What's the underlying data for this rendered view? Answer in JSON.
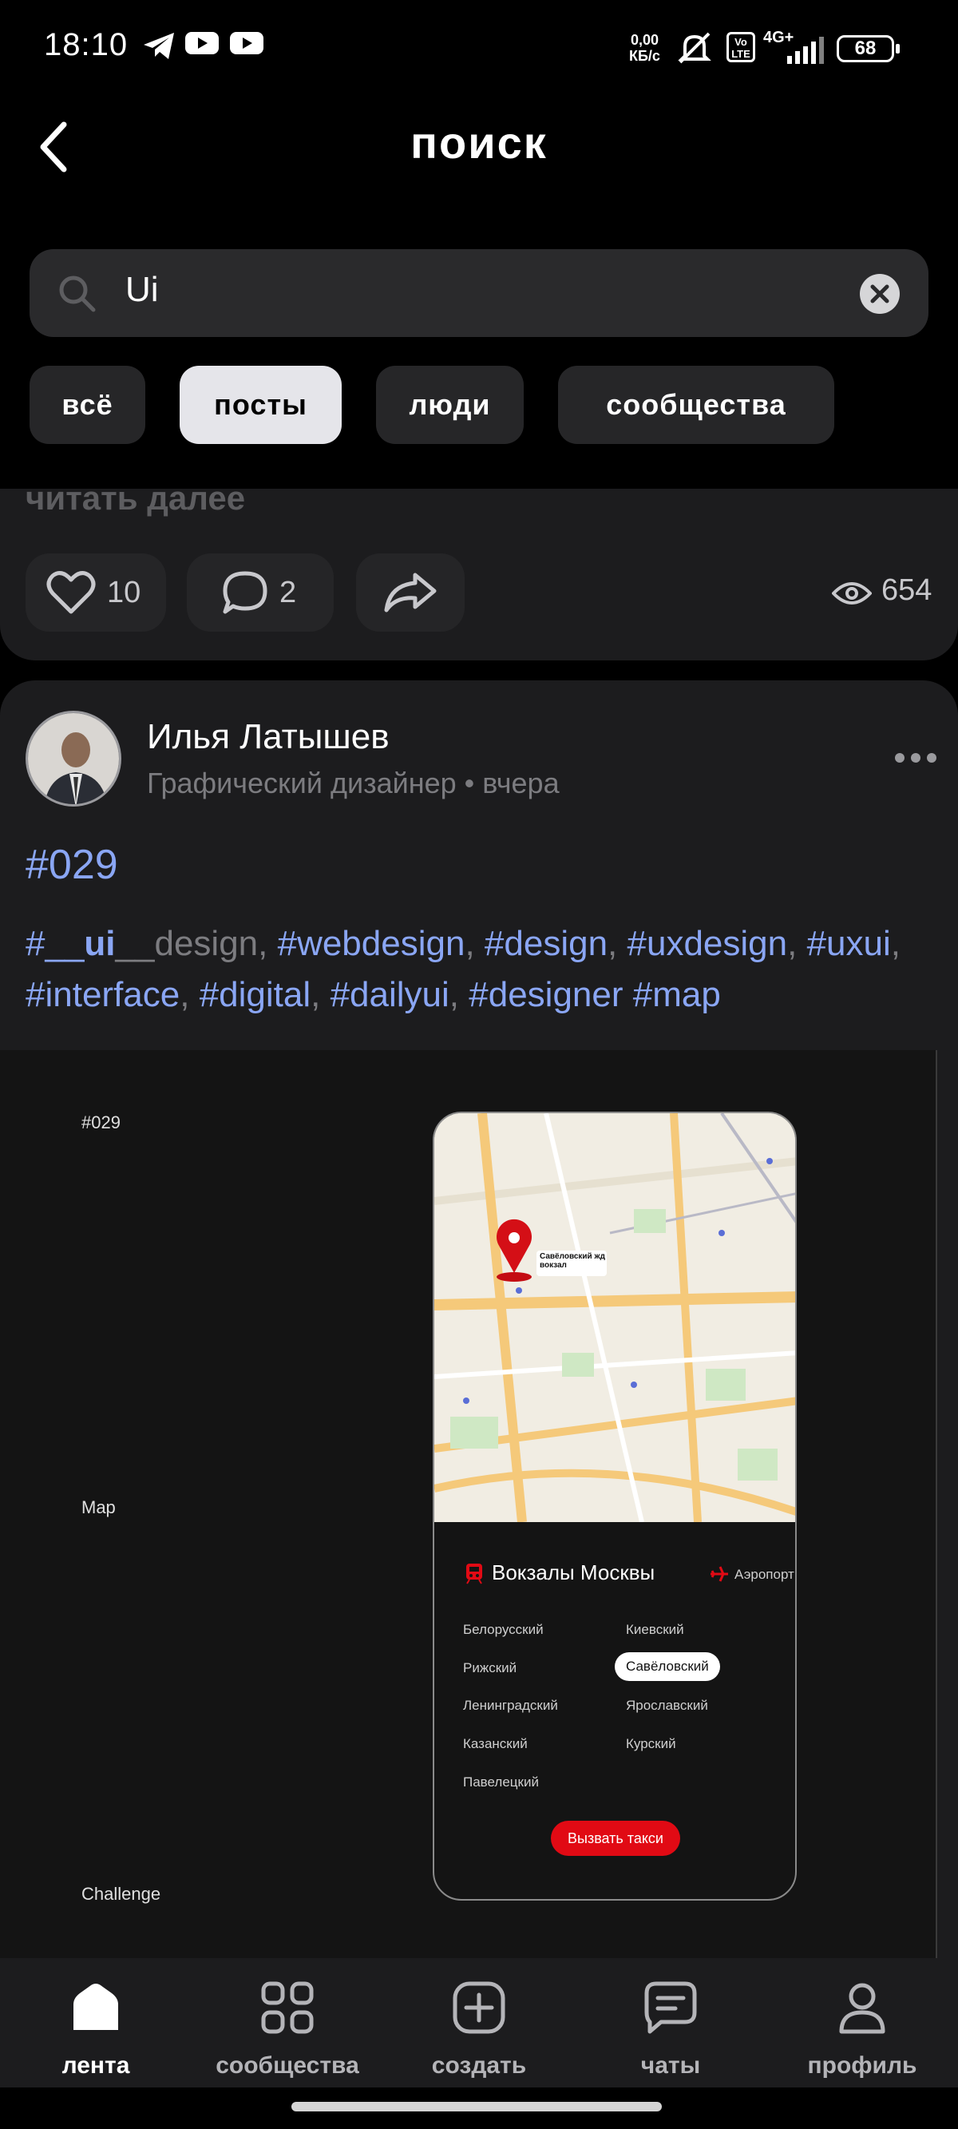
{
  "status_bar": {
    "time": "18:10",
    "net_speed_value": "0,00",
    "net_speed_unit": "КБ/с",
    "volte": "Vo LTE",
    "network": "4G+",
    "battery": "68"
  },
  "header": {
    "title": "поиск"
  },
  "search": {
    "value": "Ui"
  },
  "filters": [
    {
      "label": "всё",
      "active": false
    },
    {
      "label": "посты",
      "active": true
    },
    {
      "label": "люди",
      "active": false
    },
    {
      "label": "сообщества",
      "active": false
    }
  ],
  "post_prev": {
    "read_more": "читать далее",
    "likes": "10",
    "comments": "2",
    "views": "654"
  },
  "post": {
    "author": "Илья Латышев",
    "subtitle": "Графический дизайнер • вчера",
    "title": "#029",
    "tags_line1": [
      {
        "text": "#__",
        "dim": false
      },
      {
        "text": "ui",
        "dim": false,
        "bold": true
      },
      {
        "text": "__design, ",
        "dim": true
      },
      {
        "text": "#webdesign",
        "dim": false
      },
      {
        "text": ", ",
        "dim": true
      },
      {
        "text": "#design",
        "dim": false
      },
      {
        "text": ", ",
        "dim": true
      },
      {
        "text": "#uxdesign",
        "dim": false
      },
      {
        "text": ", ",
        "dim": true
      },
      {
        "text": "#uxui",
        "dim": false
      },
      {
        "text": ",",
        "dim": true
      }
    ],
    "tags_line2": [
      {
        "text": "#interface",
        "dim": false
      },
      {
        "text": ", ",
        "dim": true
      },
      {
        "text": "#digital",
        "dim": false
      },
      {
        "text": ", ",
        "dim": true
      },
      {
        "text": "#dailyui",
        "dim": false
      },
      {
        "text": ", ",
        "dim": true
      },
      {
        "text": "#designer",
        "dim": false
      },
      {
        "text": " ",
        "dim": true
      },
      {
        "text": "#map",
        "dim": false
      }
    ],
    "image": {
      "label_top": "#029",
      "label_mid": "Map",
      "label_bottom": "Challenge",
      "map_pin_label": "Савёловский жд вокзал",
      "panel_title": "Вокзалы Москвы",
      "panel_tab_2": "Аэропорт",
      "stations_left": [
        "Белорусский",
        "Рижский",
        "Ленинградский",
        "Казанский",
        "Павелецкий"
      ],
      "stations_right": [
        "Киевский",
        "Савёловский",
        "Ярославский",
        "Курский"
      ],
      "selected_station": "Савёловский",
      "cta": "Вызвать такси"
    }
  },
  "bottom_nav": [
    {
      "label": "лента",
      "icon": "home-icon",
      "active": true
    },
    {
      "label": "сообщества",
      "icon": "grid-icon",
      "active": false
    },
    {
      "label": "создать",
      "icon": "plus-square-icon",
      "active": false
    },
    {
      "label": "чаты",
      "icon": "chat-icon",
      "active": false
    },
    {
      "label": "профиль",
      "icon": "user-icon",
      "active": false
    }
  ]
}
